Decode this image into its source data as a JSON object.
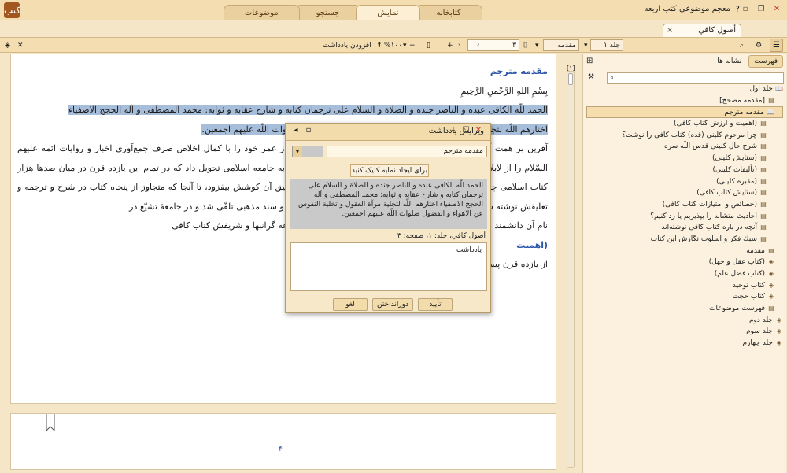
{
  "app": {
    "title": "معجم موضوعی کتب اربعه",
    "logo": "کتب",
    "tabs": [
      "کتابخانه",
      "نمایش",
      "جستجو",
      "موضوعات"
    ],
    "active_tab": 1
  },
  "book_tab": {
    "label": "أصول کافي"
  },
  "toolbar": {
    "volume": "جلد ۱",
    "section": "مقدمه",
    "page": "۳",
    "total_pages": "۲۱",
    "zoom": "%۱۰۰",
    "add_note": "افزودن یادداشت"
  },
  "doc": {
    "heading": "مقدمه مترجم",
    "bismillah": "بِسْمِ اللهِ الرَّحْمنِ الرَّحِيمِ",
    "highlight1": "الحمد للّه الكافى عبده و الناصر جنده و الصلاة و السلام على ترجمان كتابه و شارح عقابه و ثوابه: محمد المصطفى و آله الحجج الاصفياء",
    "highlight2": "اختارهم اللّه لتجلية مرآة العقول و تخلية النفوس عن الاهواء و الفضول صلوات اللّه عليهم اجمعين.",
    "para": "آفرین بر همت آن بزرگمردى كه در يازده قرن پيش، مدّت بيست سال از عمر خود را با كمال اخلاص صرف جمع‌آورى اخبار و روايات ائمه عليهم السّلام را از لابلاى كتب و رساله‌ها برگزيد و مجموعه‌ئى نفيس و بى‌نظير به جامعه اسلامى تحويل داد كه در تمام اين يازده قرن در ميان صدها هزار كتاب اسلامى چون خورشيد درخشيد و دانشمندان در شرح و ترجمه و تعليق آن كوشش بيفزود، تا آنجا كه متجاوز از پنجاه كتاب در شرح و ترجمه و تعليقش نوشته شد و همگى آن را چون فرقدان و مؤلفين بعنوان يك حجت و سند مذهبى تلقّى شد و در جامعۀ تشيّع در",
    "para2": "نام آن دانشمند بزرگ محمد بن يعقوب بن اسحاق كلينى رازى و نام مجموعه گرانبها و شريفش كتاب كافى",
    "heading2": "(اهميت",
    "para3": "از يازده قرن پيش تا كنون دانشمندان بزرگ و نوابغ عظيم اسلام بدانست",
    "page_number": "۴",
    "marker": "[۱]"
  },
  "dialog": {
    "title": "ویرایش یادداشت",
    "category": "مقدمه مترجم",
    "hint": "برای ایجاد نمایه کلیک کنید",
    "quote": "الحمد للّه الكافى عبده و الناصر جنده و الصلاة و السلام على ترجمان كتابه و شارح عقابه و ثوابه: محمد المصطفى و آله الحجج الاصفياء اختارهم اللّه لتجلية مرآة العقول و تخلية النفوس عن الاهواء و الفضول صلوات اللّه عليهم اجمعين.",
    "ref": "أصول کافي، جلد: ۱، صفحه: ۳",
    "note": "یادداشت",
    "confirm": "تأیید",
    "discard": "دورانداختن",
    "cancel": "لغو"
  },
  "panel": {
    "tabs": [
      "فهرست",
      "نشانه ها"
    ],
    "tree": [
      {
        "label": "جلد اول",
        "level": 0,
        "icon": "book-icon"
      },
      {
        "label": "[مقدمه مصحح]",
        "level": 1,
        "icon": "doc-icon"
      },
      {
        "label": "مقدمه مترجم",
        "level": 1,
        "icon": "book-icon",
        "selected": true
      },
      {
        "label": "(اهميت و ارزش كتاب كافى)",
        "level": 2,
        "icon": "doc-icon"
      },
      {
        "label": "چرا مرحوم كلينى (قده) كتاب كافى را نوشت؟",
        "level": 2,
        "icon": "doc-icon"
      },
      {
        "label": "شرح حال كلينى قدس اللّه سره",
        "level": 2,
        "icon": "doc-icon"
      },
      {
        "label": "(ستايش كلينى)",
        "level": 2,
        "icon": "doc-icon"
      },
      {
        "label": "(تأليفات كلينى)",
        "level": 2,
        "icon": "doc-icon"
      },
      {
        "label": "(مقبره كلينى)",
        "level": 2,
        "icon": "doc-icon"
      },
      {
        "label": "(ستايش كتاب كافى)",
        "level": 2,
        "icon": "doc-icon"
      },
      {
        "label": "(خصائص و امتيازات كتاب كافى)",
        "level": 2,
        "icon": "doc-icon"
      },
      {
        "label": "احاديث متشابه را بپذيريم يا رد كنيم؟",
        "level": 2,
        "icon": "doc-icon"
      },
      {
        "label": "آنچه در باره كتاب كافى نوشته‌اند",
        "level": 2,
        "icon": "doc-icon"
      },
      {
        "label": "سبك فكر و اسلوب نگارش اين كتاب",
        "level": 2,
        "icon": "doc-icon"
      },
      {
        "label": "مقدمه",
        "level": 1,
        "icon": "doc-icon"
      },
      {
        "label": "(كتاب عقل و جهل)",
        "level": 1,
        "icon": "folder-icon"
      },
      {
        "label": "(كتاب فضل علم)",
        "level": 1,
        "icon": "folder-icon"
      },
      {
        "label": "كتاب توحيد",
        "level": 1,
        "icon": "folder-icon"
      },
      {
        "label": "كتاب حجت",
        "level": 1,
        "icon": "folder-icon"
      },
      {
        "label": "فهرست موضوعات",
        "level": 1,
        "icon": "doc-icon"
      },
      {
        "label": "جلد دوم",
        "level": 0,
        "icon": "folder-icon"
      },
      {
        "label": "جلد سوم",
        "level": 0,
        "icon": "folder-icon"
      },
      {
        "label": "جلد چهارم",
        "level": 0,
        "icon": "folder-icon"
      }
    ]
  }
}
